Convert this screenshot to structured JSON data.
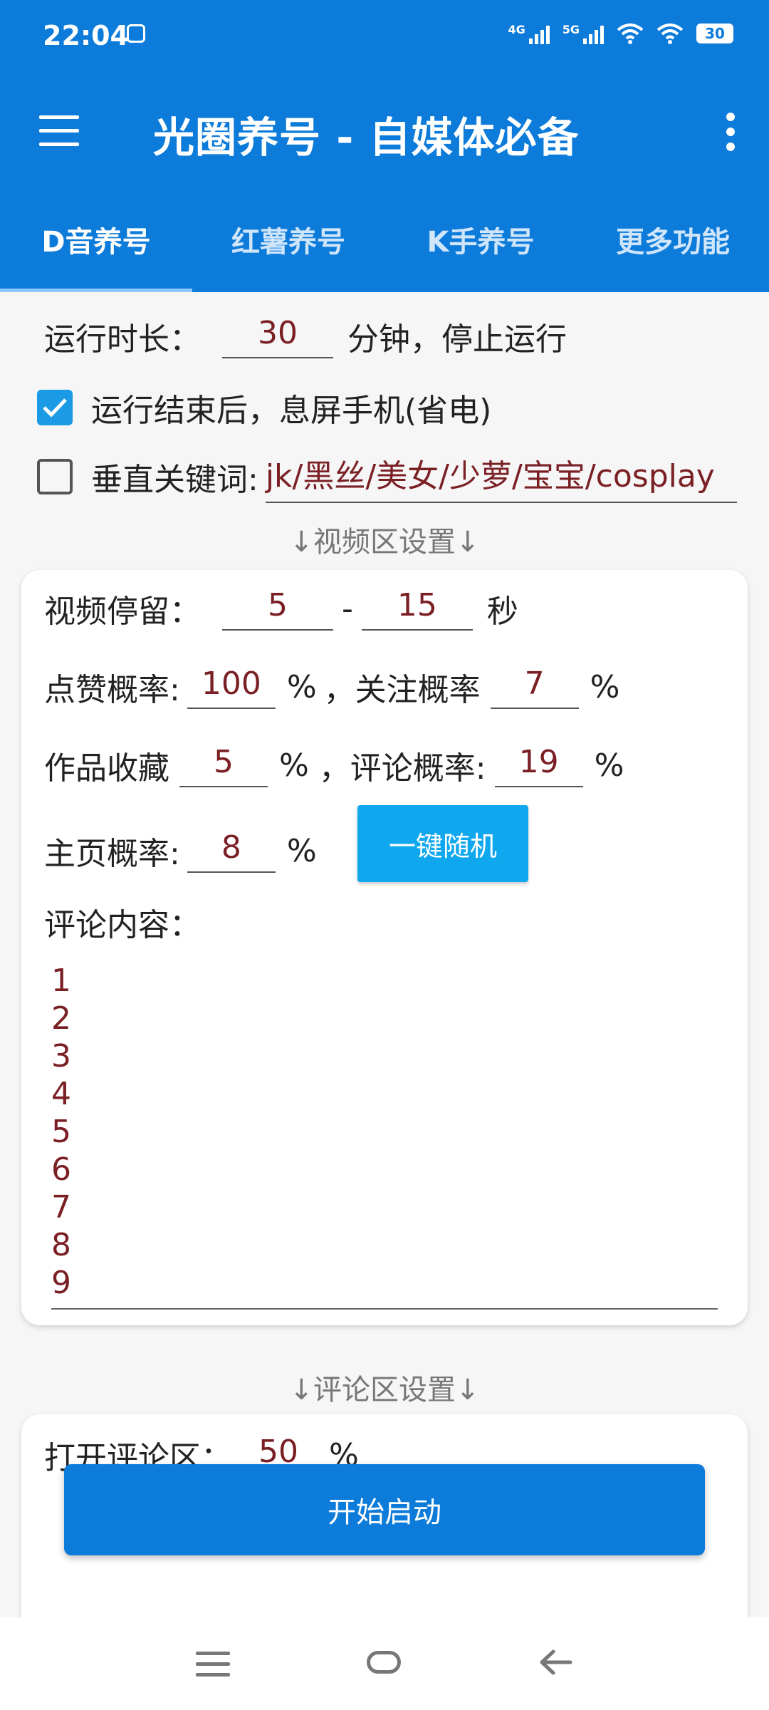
{
  "status_bar": {
    "time": "22:04",
    "net1": "4G",
    "net2": "5G",
    "battery": "30"
  },
  "app_bar": {
    "title": "光圈养号 - 自媒体必备"
  },
  "tabs": [
    {
      "label": "D音养号",
      "active": true
    },
    {
      "label": "红薯养号",
      "active": false
    },
    {
      "label": "K手养号",
      "active": false
    },
    {
      "label": "更多功能",
      "active": false
    }
  ],
  "run": {
    "label": "运行时长：",
    "value": "30",
    "suffix": "分钟，停止运行"
  },
  "screen_off": {
    "label": "运行结束后，息屏手机(省电)",
    "checked": true
  },
  "keywords": {
    "label": "垂直关键词:",
    "value": "jk/黑丝/美女/少萝/宝宝/cosplay",
    "checked": false
  },
  "video_section": {
    "title": "↓视频区设置↓",
    "stay": {
      "label": "视频停留：",
      "min": "5",
      "dash": "-",
      "max": "15",
      "unit": "秒"
    },
    "like": {
      "label": "点赞概率:",
      "value": "100",
      "unit": "%"
    },
    "follow": {
      "label": "，关注概率",
      "value": "7",
      "unit": "%"
    },
    "collect": {
      "label": "作品收藏",
      "value": "5",
      "unit": "%"
    },
    "comment_rate": {
      "label": "，评论概率:",
      "value": "19",
      "unit": "%"
    },
    "homepage": {
      "label": "主页概率:",
      "value": "8",
      "unit": "%"
    },
    "random_button": "一键随机",
    "comment_label": "评论内容：",
    "comment_lines": [
      "1",
      "2",
      "3",
      "4",
      "5",
      "6",
      "7",
      "8",
      "9"
    ]
  },
  "comment_section": {
    "title": "↓评论区设置↓",
    "open_label": "打开评论区：",
    "open_value": "50",
    "open_unit": "%"
  },
  "start_button": "开始启动",
  "colors": {
    "primary": "#0c7bd9",
    "accent": "#0fa8ee",
    "value_text": "#7a1f24"
  }
}
